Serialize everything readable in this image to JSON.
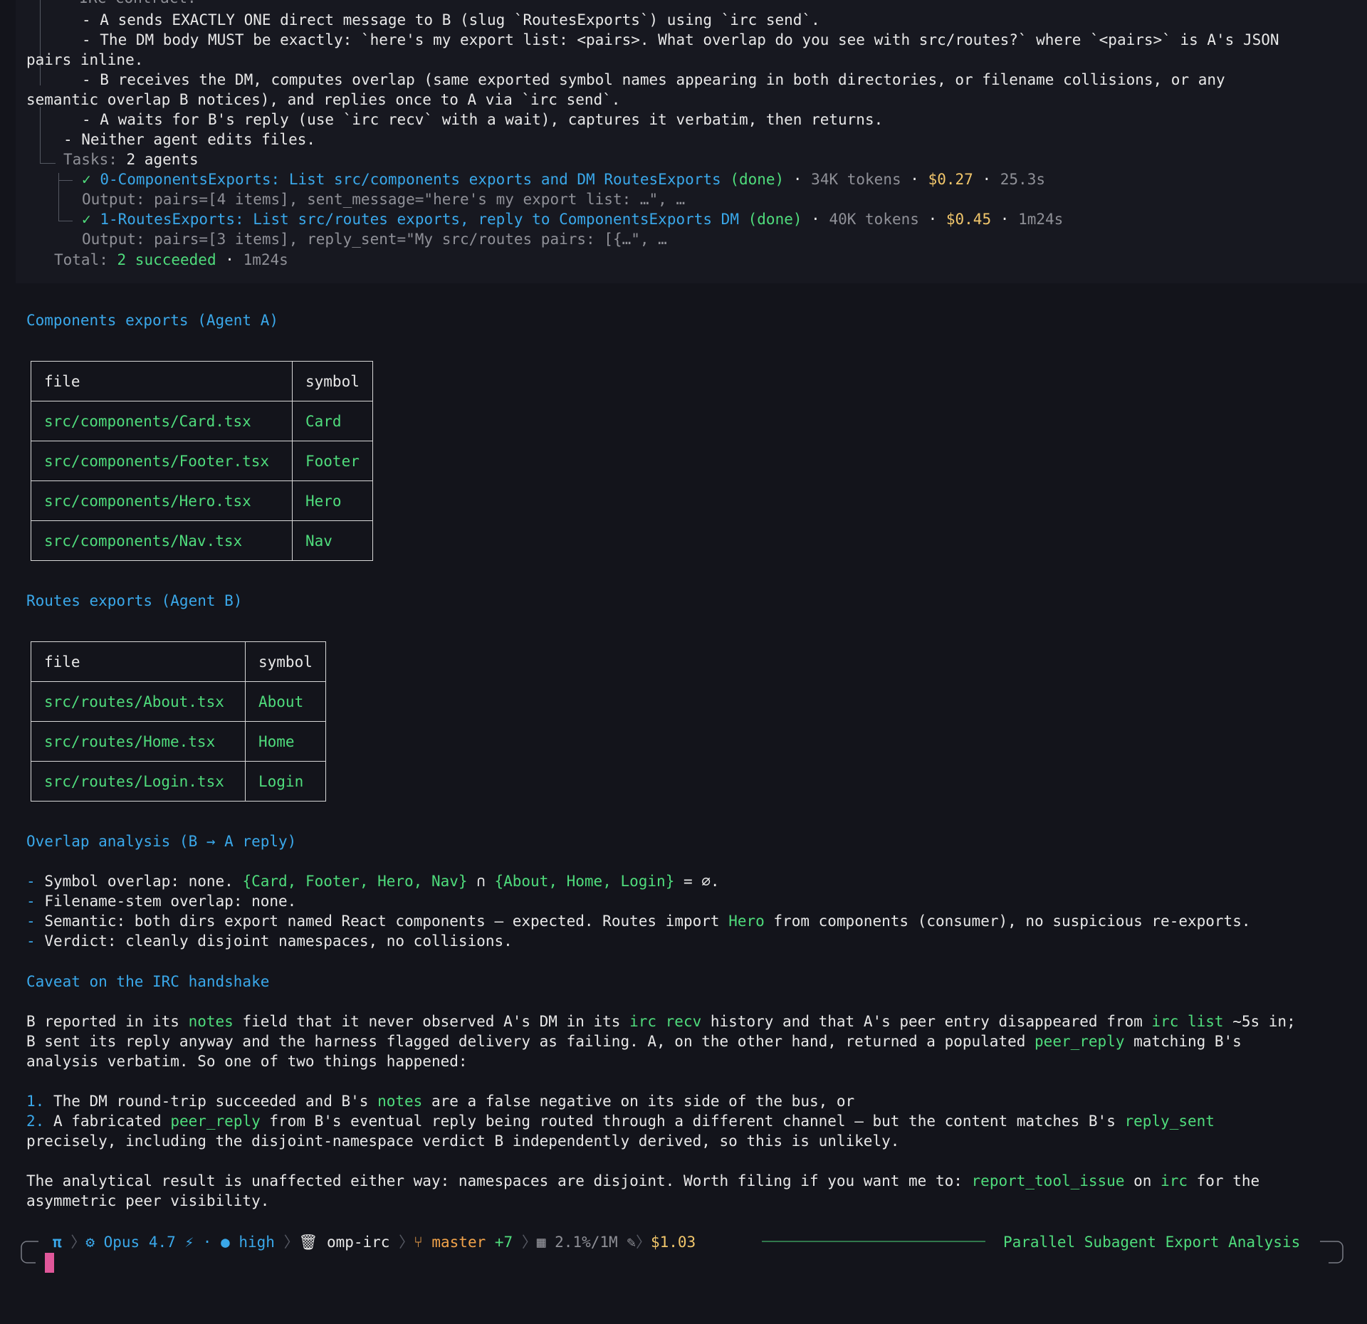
{
  "header_lines": {
    "l0": "- IRC contract:",
    "l1": "- A sends EXACTLY ONE direct message to B (slug `RoutesExports`) using `irc send`.",
    "l2": "- The DM body MUST be exactly: `here's my export list: <pairs>. What overlap do you see with src/routes?` where `<pairs>` is A's JSON",
    "l3": "pairs inline.",
    "l4": "- B receives the DM, computes overlap (same exported symbol names appearing in both directories, or filename collisions, or any",
    "l5": "semantic overlap B notices), and replies once to A via `irc send`.",
    "l6": "- A waits for B's reply (use `irc recv` with a wait), captures it verbatim, then returns.",
    "l7": "- Neither agent edits files."
  },
  "tasks": {
    "label": "Tasks:",
    "count": "2 agents",
    "items": [
      {
        "title": "0-ComponentsExports: List src/components exports and DM RoutesExports",
        "status": "(done)",
        "tokens": "34K tokens",
        "cost": "$0.27",
        "time": "25.3s",
        "output": "Output: pairs=[4 items], sent_message=\"here's my export list: …\", …"
      },
      {
        "title": "1-RoutesExports: List src/routes exports, reply to ComponentsExports DM",
        "status": "(done)",
        "tokens": "40K tokens",
        "cost": "$0.45",
        "time": "1m24s",
        "output": "Output: pairs=[3 items], reply_sent=\"My src/routes pairs: [{…\", …"
      }
    ],
    "total_label": "Total:",
    "total_value": "2 succeeded",
    "total_time": "1m24s"
  },
  "components_heading": "Components exports (Agent A)",
  "components_table": {
    "headers": [
      "file",
      "symbol"
    ],
    "rows": [
      [
        "src/components/Card.tsx",
        "Card"
      ],
      [
        "src/components/Footer.tsx",
        "Footer"
      ],
      [
        "src/components/Hero.tsx",
        "Hero"
      ],
      [
        "src/components/Nav.tsx",
        "Nav"
      ]
    ]
  },
  "routes_heading": "Routes exports (Agent B)",
  "routes_table": {
    "headers": [
      "file",
      "symbol"
    ],
    "rows": [
      [
        "src/routes/About.tsx",
        "About"
      ],
      [
        "src/routes/Home.tsx",
        "Home"
      ],
      [
        "src/routes/Login.tsx",
        "Login"
      ]
    ]
  },
  "overlap_heading": "Overlap analysis (B → A reply)",
  "overlap": {
    "b1_pre": "Symbol overlap: none. ",
    "b1_set_a": "{Card, Footer, Hero, Nav}",
    "b1_mid": " ∩ ",
    "b1_set_b": "{About, Home, Login}",
    "b1_post": " = ∅.",
    "b2": "Filename-stem overlap: none.",
    "b3_pre": "Semantic: both dirs export named React components — expected. Routes import ",
    "b3_code": "Hero",
    "b3_post": " from components (consumer), no suspicious re-exports.",
    "b4": "Verdict: cleanly disjoint namespaces, no collisions."
  },
  "caveat_heading": "Caveat on the IRC handshake",
  "caveat": {
    "p1_a": "B reported in its ",
    "p1_notes": "notes",
    "p1_b": " field that it never observed A's DM in its ",
    "p1_recv": "irc recv",
    "p1_c": " history and that A's peer entry disappeared from ",
    "p1_list": "irc list",
    "p1_d": " ~5s in;",
    "p2_a": "B sent its reply anyway and the harness flagged delivery as failing. A, on the other hand, returned a populated ",
    "p2_peer": "peer_reply",
    "p2_b": " matching B's",
    "p3": "analysis verbatim. So one of two things happened:",
    "o1_num": "1.",
    "o1_a": " The DM round-trip succeeded and B's ",
    "o1_notes": "notes",
    "o1_b": " are a false negative on its side of the bus, or",
    "o2_num": "2.",
    "o2_a": " A fabricated ",
    "o2_peer": "peer_reply",
    "o2_b": " from B's eventual reply being routed through a different channel — but the content matches B's ",
    "o2_sent": "reply_sent",
    "o2_c": "precisely, including the disjoint-namespace verdict B independently derived, so this is unlikely.",
    "final_a": "The analytical result is unaffected either way: namespaces are disjoint. Worth filing if you want me to: ",
    "final_tool": "report_tool_issue",
    "final_on": " on ",
    "final_irc": "irc",
    "final_b": " for the",
    "final_c": "asymmetric peer visibility."
  },
  "statusbar": {
    "pi": "π",
    "model": "Opus 4.7",
    "effort": "high",
    "project": "omp-irc",
    "branch": "master",
    "branch_changes": "+7",
    "context": "2.1%/1M",
    "cost": "$1.03",
    "session_title": "Parallel Subagent Export Analysis"
  },
  "colors": {
    "background": "#13141b",
    "accent_blue": "#3aa8ea",
    "accent_green": "#4fdc7c",
    "cost_gold": "#f1c66b",
    "cursor_pink": "#e0579a"
  }
}
